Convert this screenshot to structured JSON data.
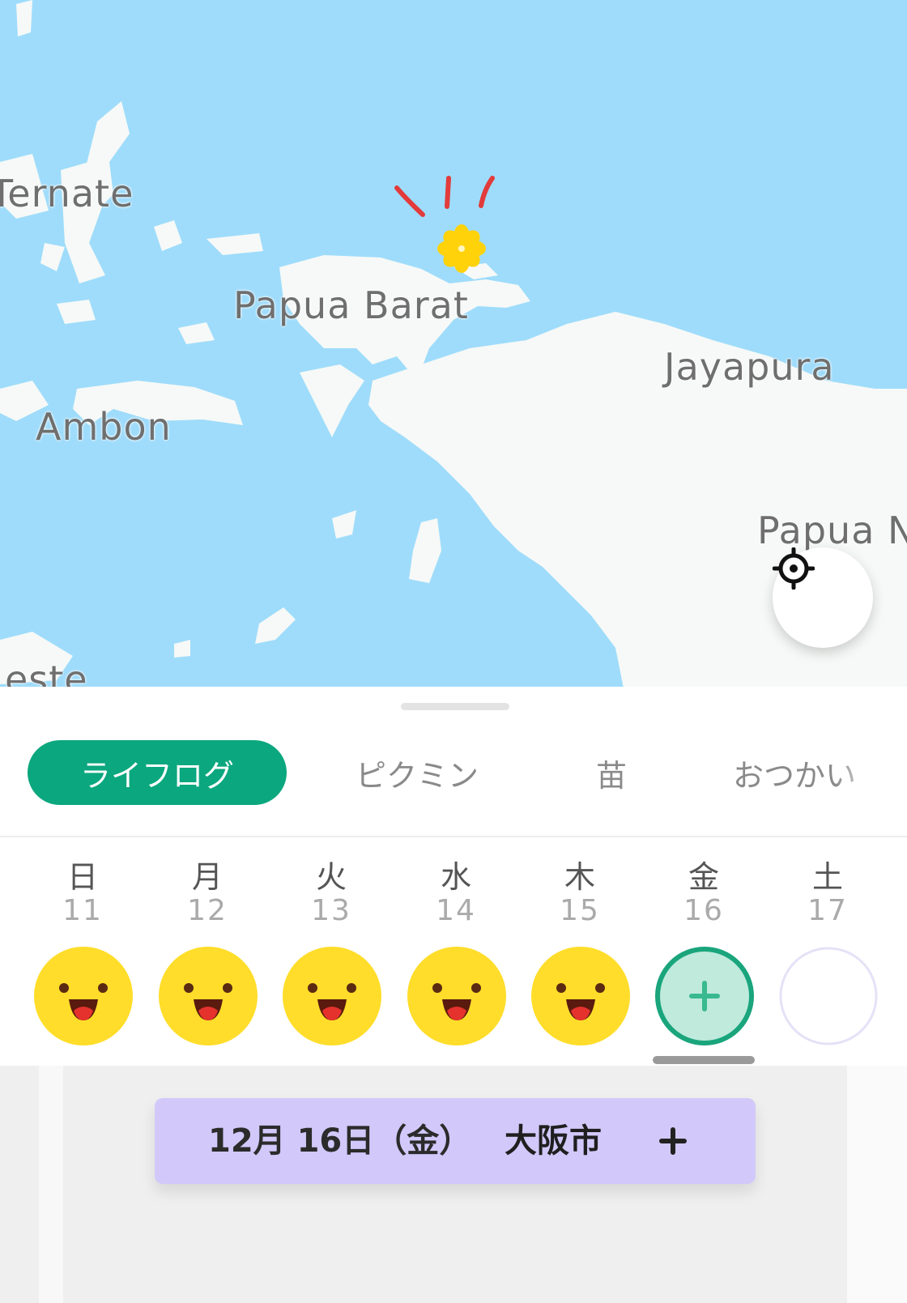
{
  "map": {
    "labels": {
      "ternate": "Ternate",
      "papua_barat": "Papua Barat",
      "jayapura": "Jayapura",
      "ambon": "Ambon",
      "papua_n": "Papua N",
      "este": "este"
    },
    "marker_icon": "yellow-flower-marker",
    "locate_icon": "crosshair-locate-icon",
    "colors": {
      "water": "#9fdcfb",
      "land": "#f6f9f7",
      "marker": "#ffd20a",
      "spark": "#e23b3b"
    }
  },
  "tabs": [
    {
      "label": "ライフログ",
      "active": true
    },
    {
      "label": "ピクミン",
      "active": false
    },
    {
      "label": "苗",
      "active": false
    },
    {
      "label": "おつかい",
      "active": false
    }
  ],
  "week": [
    {
      "name": "日",
      "num": "11",
      "state": "happy"
    },
    {
      "name": "月",
      "num": "12",
      "state": "happy"
    },
    {
      "name": "火",
      "num": "13",
      "state": "happy"
    },
    {
      "name": "水",
      "num": "14",
      "state": "happy"
    },
    {
      "name": "木",
      "num": "15",
      "state": "happy"
    },
    {
      "name": "金",
      "num": "16",
      "state": "add"
    },
    {
      "name": "土",
      "num": "17",
      "state": "empty"
    }
  ],
  "date_bar": {
    "date": "12月 16日（金）",
    "city": "大阪市",
    "add_icon": "plus-icon"
  },
  "colors": {
    "accent": "#0ba77e",
    "pill": "#d2c9fa",
    "face": "#ffdd2a",
    "add_fill": "#bfeadc"
  }
}
